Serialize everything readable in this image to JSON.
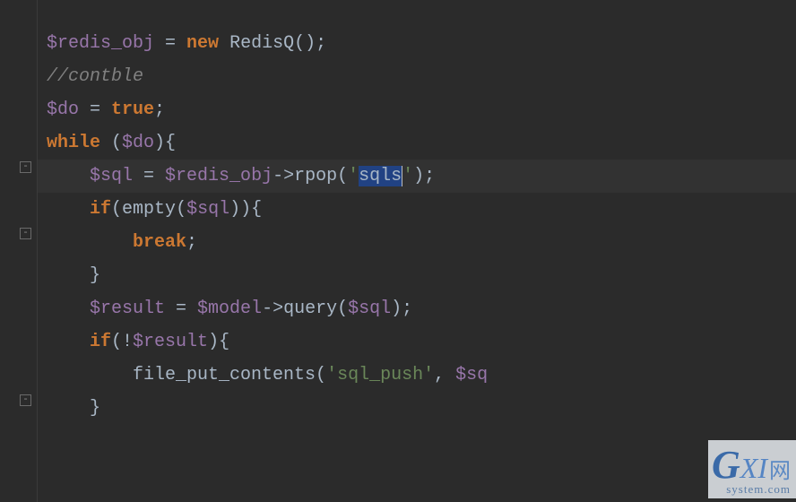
{
  "code_lines": {
    "l1": {
      "p1": "$redis_obj",
      "p2": " = ",
      "p3": "new",
      "p4": " RedisQ();"
    },
    "l2": {
      "p1": "//contble"
    },
    "l3": {
      "p1": "$do",
      "p2": " = ",
      "p3": "true",
      "p4": ";"
    },
    "l4": {
      "p1": "while",
      "p2": " (",
      "p3": "$do",
      "p4": "){"
    },
    "l5": {
      "p1": "    ",
      "p2": "$sql",
      "p3": " = ",
      "p4": "$redis_obj",
      "p5": "->rpop(",
      "p6": "'",
      "sel": "sqls",
      "p7": "'",
      "p8": ");"
    },
    "l6": {
      "p1": "    ",
      "p2": "if",
      "p3": "(",
      "p4": "empty",
      "p5": "(",
      "p6": "$sql",
      "p7": ")){"
    },
    "l7": {
      "p1": "        ",
      "p2": "break",
      "p3": ";"
    },
    "l8": {
      "p1": "    }"
    },
    "l9": {
      "p1": "    ",
      "p2": "$result",
      "p3": " = ",
      "p4": "$model",
      "p5": "->query(",
      "p6": "$sql",
      "p7": ");"
    },
    "l10": {
      "p1": "    ",
      "p2": "if",
      "p3": "(!",
      "p4": "$result",
      "p5": "){"
    },
    "l11": {
      "p1": "        file_put_contents(",
      "p2": "'sql_push'",
      "p3": ", ",
      "p4": "$sq"
    },
    "l12": {
      "p1": "    }"
    }
  },
  "fold_buttons": {
    "b1": "-",
    "b2": "-",
    "b3": "-"
  },
  "watermark": {
    "g": "G",
    "xi": "XI",
    "wang": "网",
    "sys": "system.com"
  }
}
